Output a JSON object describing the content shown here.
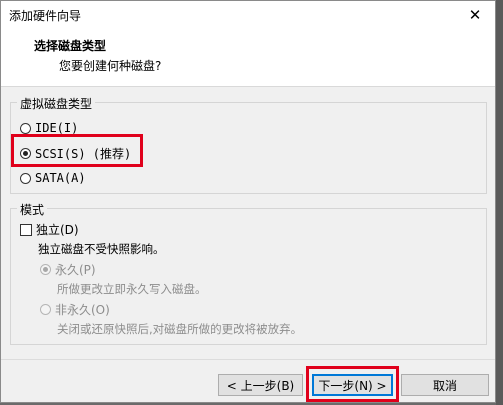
{
  "window": {
    "title": "添加硬件向导",
    "close_glyph": "✕"
  },
  "header": {
    "title": "选择磁盘类型",
    "subtitle": "您要创建何种磁盘?"
  },
  "disk_type": {
    "legend": "虚拟磁盘类型",
    "options": [
      {
        "label": "IDE(I)",
        "selected": false
      },
      {
        "label": "SCSI(S)  (推荐)",
        "selected": true
      },
      {
        "label": "SATA(A)",
        "selected": false
      }
    ]
  },
  "mode": {
    "legend": "模式",
    "independent": {
      "label": "独立(D)",
      "checked": false
    },
    "independent_desc": "独立磁盘不受快照影响。",
    "persistent": {
      "label": "永久(P)",
      "selected": true,
      "desc": "所做更改立即永久写入磁盘。"
    },
    "nonpersistent": {
      "label": "非永久(O)",
      "selected": false,
      "desc": "关闭或还原快照后,对磁盘所做的更改将被放弃。"
    }
  },
  "buttons": {
    "back": "< 上一步(B)",
    "next": "下一步(N) >",
    "cancel": "取消"
  },
  "colors": {
    "highlight": "#e0001b",
    "focus": "#0078d7"
  }
}
